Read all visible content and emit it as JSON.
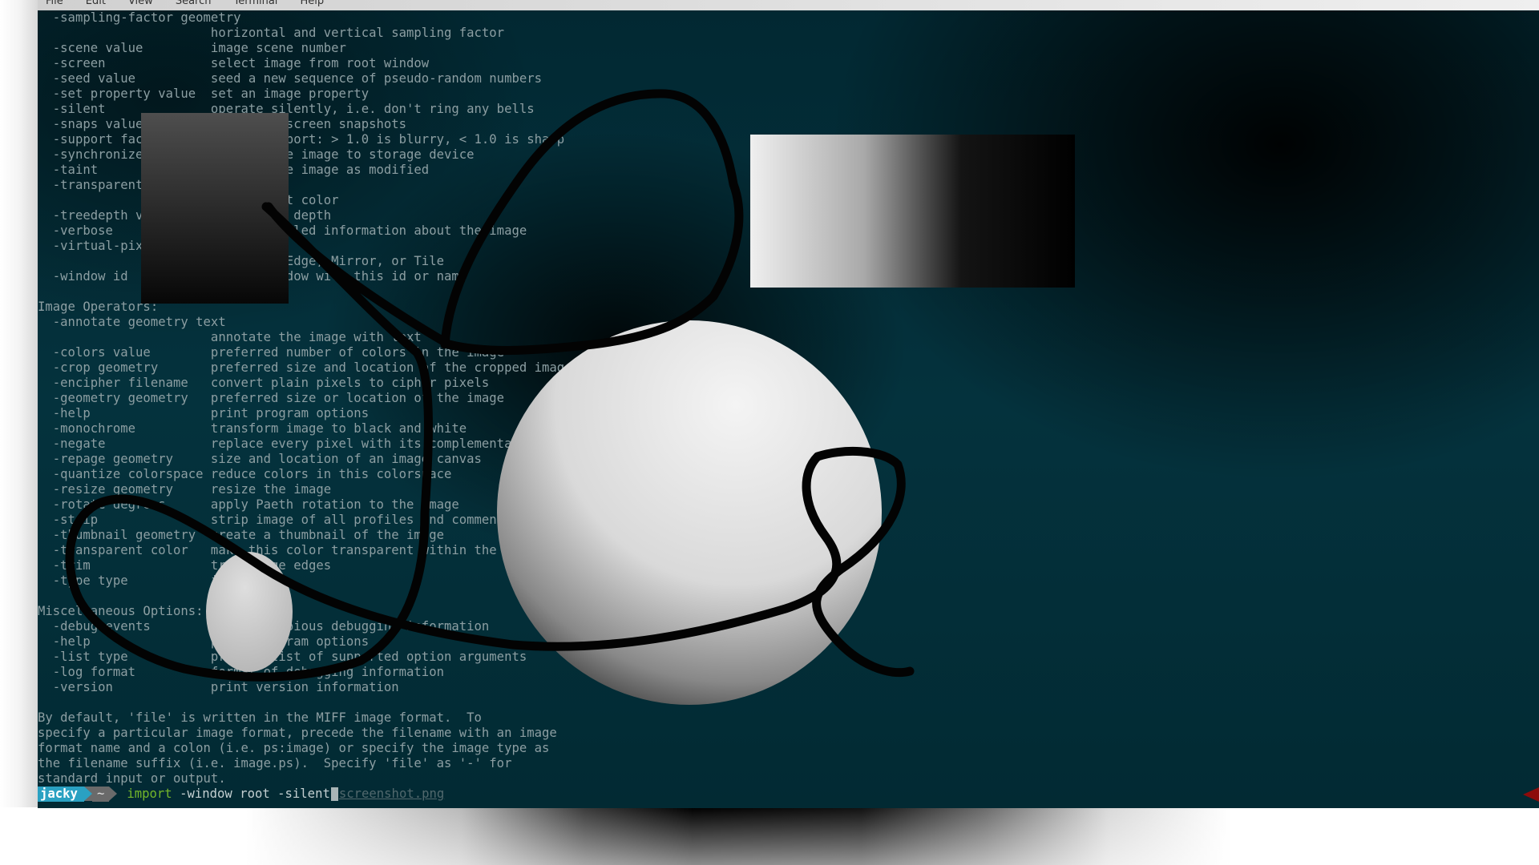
{
  "menu": [
    "File",
    "Edit",
    "View",
    "Search",
    "Terminal",
    "Help"
  ],
  "terminal_lines": [
    "  -sampling-factor geometry",
    "                       horizontal and vertical sampling factor",
    "  -scene value         image scene number",
    "  -screen              select image from root window",
    "  -seed value          seed a new sequence of pseudo-random numbers",
    "  -set property value  set an image property",
    "  -silent              operate silently, i.e. don't ring any bells",
    "  -snaps value         number of screen snapshots",
    "  -support factor      resize support: > 1.0 is blurry, < 1.0 is sharp",
    "  -synchronize         synchronize image to storage device",
    "  -taint               declare the image as modified",
    "  -transparent-color color",
    "                       transparent color",
    "  -treedepth value     color tree depth",
    "  -verbose             print detailed information about the image",
    "  -virtual-pixel method",
    "                       Constant, Edge, Mirror, or Tile",
    "  -window id           select window with this id or name",
    "",
    "Image Operators:",
    "  -annotate geometry text",
    "                       annotate the image with text",
    "  -colors value        preferred number of colors in the image",
    "  -crop geometry       preferred size and location of the cropped image",
    "  -encipher filename   convert plain pixels to cipher pixels",
    "  -geometry geometry   preferred size or location of the image",
    "  -help                print program options",
    "  -monochrome          transform image to black and white",
    "  -negate              replace every pixel with its complementary color",
    "  -repage geometry     size and location of an image canvas",
    "  -quantize colorspace reduce colors in this colorspace",
    "  -resize geometry     resize the image",
    "  -rotate degrees      apply Paeth rotation to the image",
    "  -strip               strip image of all profiles and comments",
    "  -thumbnail geometry  create a thumbnail of the image",
    "  -transparent color   make this color transparent within the image",
    "  -trim                trim image edges",
    "  -type type           image type",
    "",
    "Miscellaneous Options:",
    "  -debug events        display copious debugging information",
    "  -help                print program options",
    "  -list type           print a list of supported option arguments",
    "  -log format          format of debugging information",
    "  -version             print version information",
    "",
    "By default, 'file' is written in the MIFF image format.  To",
    "specify a particular image format, precede the filename with an image",
    "format name and a colon (i.e. ps:image) or specify the image type as",
    "the filename suffix (i.e. image.ps).  Specify 'file' as '-' for",
    "standard input or output."
  ],
  "prompt": {
    "user": "jacky",
    "directory": "~",
    "command": "import",
    "arguments": " -window root -silent",
    "autosuggestion": "screenshot.png"
  },
  "colors": {
    "terminal_background": "#04323d",
    "text": "#8c9ea2",
    "prompt_user_bg": "#2aa1c2",
    "command": "#74b62a",
    "marker": "#8d0b0b"
  }
}
